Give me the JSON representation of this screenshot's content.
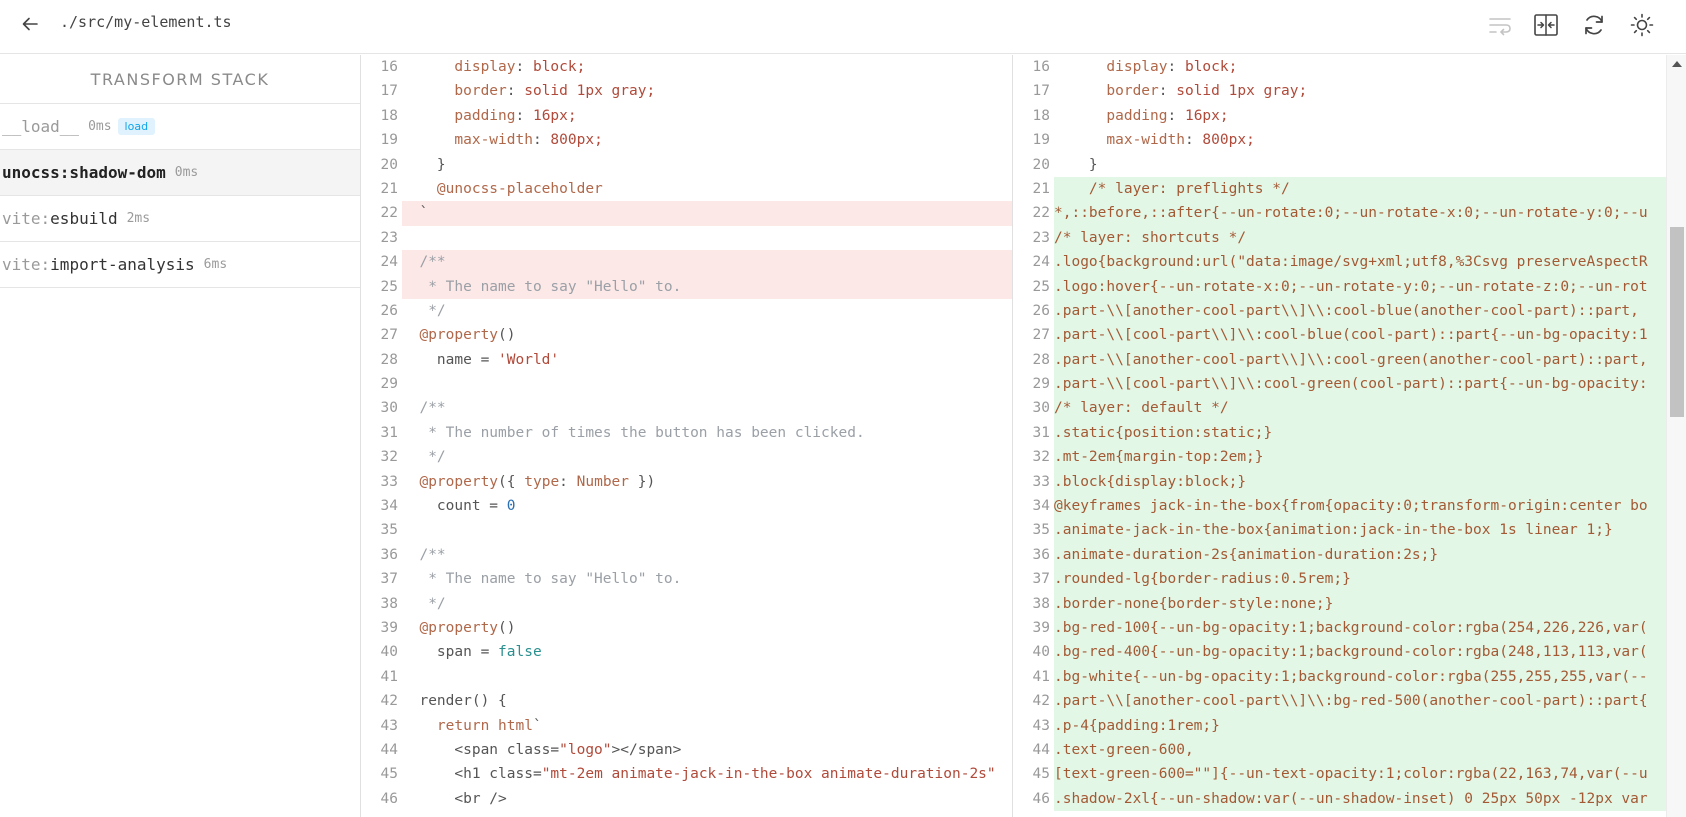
{
  "header": {
    "file_path": "./src/my-element.ts",
    "icons": [
      "arrow-left-icon",
      "wrap-text-icon",
      "split-view-icon",
      "refresh-icon",
      "sun-icon"
    ]
  },
  "sidebar": {
    "title": "TRANSFORM STACK",
    "items": [
      {
        "prefix": "",
        "name": "__load__",
        "ms": "0ms",
        "badge": "load"
      },
      {
        "prefix": "",
        "name": "unocss:shadow-dom",
        "ms": "0ms",
        "badge": ""
      },
      {
        "prefix": "vite:",
        "name": "esbuild",
        "ms": "2ms",
        "badge": ""
      },
      {
        "prefix": "vite:",
        "name": "import-analysis",
        "ms": "6ms",
        "badge": ""
      }
    ]
  },
  "left_pane": {
    "lines": [
      {
        "n": "16",
        "t": "      display: block;"
      },
      {
        "n": "17",
        "t": "      border: solid 1px gray;"
      },
      {
        "n": "18",
        "t": "      padding: 16px;"
      },
      {
        "n": "19",
        "t": "      max-width: 800px;"
      },
      {
        "n": "20",
        "t": "    }"
      },
      {
        "n": "21",
        "t": "    @unocss-placeholder"
      },
      {
        "n": "22",
        "t": "  `",
        "diff": "removed"
      },
      {
        "n": "23",
        "t": "",
        "diff": "removed"
      },
      {
        "n": "24",
        "t": "  /**",
        "diff": "removed"
      },
      {
        "n": "25",
        "t": "   * The name to say \"Hello\" to.",
        "diff": "removed"
      },
      {
        "n": "26",
        "t": "   */"
      },
      {
        "n": "27",
        "t": "  @property()"
      },
      {
        "n": "28",
        "t": "    name = 'World'"
      },
      {
        "n": "29",
        "t": ""
      },
      {
        "n": "30",
        "t": "  /**"
      },
      {
        "n": "31",
        "t": "   * The number of times the button has been clicked."
      },
      {
        "n": "32",
        "t": "   */"
      },
      {
        "n": "33",
        "t": "  @property({ type: Number })"
      },
      {
        "n": "34",
        "t": "    count = 0"
      },
      {
        "n": "35",
        "t": ""
      },
      {
        "n": "36",
        "t": "  /**"
      },
      {
        "n": "37",
        "t": "   * The name to say \"Hello\" to."
      },
      {
        "n": "38",
        "t": "   */"
      },
      {
        "n": "39",
        "t": "  @property()"
      },
      {
        "n": "40",
        "t": "    span = false"
      },
      {
        "n": "41",
        "t": ""
      },
      {
        "n": "42",
        "t": "  render() {"
      },
      {
        "n": "43",
        "t": "    return html`"
      },
      {
        "n": "44",
        "t": "      <span class=\"logo\"></span>"
      },
      {
        "n": "45",
        "t": "      <h1 class=\"mt-2em animate-jack-in-the-box animate-duration-2s\""
      },
      {
        "n": "46",
        "t": "      <br />"
      }
    ]
  },
  "right_pane": {
    "lines": [
      {
        "n": "16",
        "t": "      display: block;"
      },
      {
        "n": "17",
        "t": "      border: solid 1px gray;"
      },
      {
        "n": "18",
        "t": "      padding: 16px;"
      },
      {
        "n": "19",
        "t": "      max-width: 800px;"
      },
      {
        "n": "20",
        "t": "    }"
      },
      {
        "n": "21",
        "t": "    /* layer: preflights */",
        "diff": "added"
      },
      {
        "n": "22",
        "t": "*,::before,::after{--un-rotate:0;--un-rotate-x:0;--un-rotate-y:0;--u",
        "diff": "added"
      },
      {
        "n": "23",
        "t": "/* layer: shortcuts */",
        "diff": "added"
      },
      {
        "n": "24",
        "t": ".logo{background:url(\"data:image/svg+xml;utf8,%3Csvg preserveAspectR",
        "diff": "added"
      },
      {
        "n": "25",
        "t": ".logo:hover{--un-rotate-x:0;--un-rotate-y:0;--un-rotate-z:0;--un-rot",
        "diff": "added"
      },
      {
        "n": "26",
        "t": ".part-\\\\[another-cool-part\\\\]\\\\:cool-blue(another-cool-part)::part,",
        "diff": "added"
      },
      {
        "n": "27",
        "t": ".part-\\\\[cool-part\\\\]\\\\:cool-blue(cool-part)::part{--un-bg-opacity:1",
        "diff": "added"
      },
      {
        "n": "28",
        "t": ".part-\\\\[another-cool-part\\\\]\\\\:cool-green(another-cool-part)::part,",
        "diff": "added"
      },
      {
        "n": "29",
        "t": ".part-\\\\[cool-part\\\\]\\\\:cool-green(cool-part)::part{--un-bg-opacity:",
        "diff": "added"
      },
      {
        "n": "30",
        "t": "/* layer: default */",
        "diff": "added"
      },
      {
        "n": "31",
        "t": ".static{position:static;}",
        "diff": "added"
      },
      {
        "n": "32",
        "t": ".mt-2em{margin-top:2em;}",
        "diff": "added"
      },
      {
        "n": "33",
        "t": ".block{display:block;}",
        "diff": "added"
      },
      {
        "n": "34",
        "t": "@keyframes jack-in-the-box{from{opacity:0;transform-origin:center bo",
        "diff": "added"
      },
      {
        "n": "35",
        "t": ".animate-jack-in-the-box{animation:jack-in-the-box 1s linear 1;}",
        "diff": "added"
      },
      {
        "n": "36",
        "t": ".animate-duration-2s{animation-duration:2s;}",
        "diff": "added"
      },
      {
        "n": "37",
        "t": ".rounded-lg{border-radius:0.5rem;}",
        "diff": "added"
      },
      {
        "n": "38",
        "t": ".border-none{border-style:none;}",
        "diff": "added"
      },
      {
        "n": "39",
        "t": ".bg-red-100{--un-bg-opacity:1;background-color:rgba(254,226,226,var(",
        "diff": "added"
      },
      {
        "n": "40",
        "t": ".bg-red-400{--un-bg-opacity:1;background-color:rgba(248,113,113,var(",
        "diff": "added"
      },
      {
        "n": "41",
        "t": ".bg-white{--un-bg-opacity:1;background-color:rgba(255,255,255,var(--",
        "diff": "added"
      },
      {
        "n": "42",
        "t": ".part-\\\\[another-cool-part\\\\]\\\\:bg-red-500(another-cool-part)::part{",
        "diff": "added"
      },
      {
        "n": "43",
        "t": ".p-4{padding:1rem;}",
        "diff": "added"
      },
      {
        "n": "44",
        "t": ".text-green-600,",
        "diff": "added"
      },
      {
        "n": "45",
        "t": "[text-green-600=\"\"]{--un-text-opacity:1;color:rgba(22,163,74,var(--u",
        "diff": "added"
      },
      {
        "n": "46",
        "t": ".shadow-2xl{--un-shadow:var(--un-shadow-inset) 0 25px 50px -12px var",
        "diff": "added"
      }
    ]
  },
  "colors": {
    "removed_bg": "#fde8e8",
    "added_bg": "#e3f7e7",
    "badge_text": "#0ea5e9",
    "badge_bg": "#e0f2fe"
  }
}
